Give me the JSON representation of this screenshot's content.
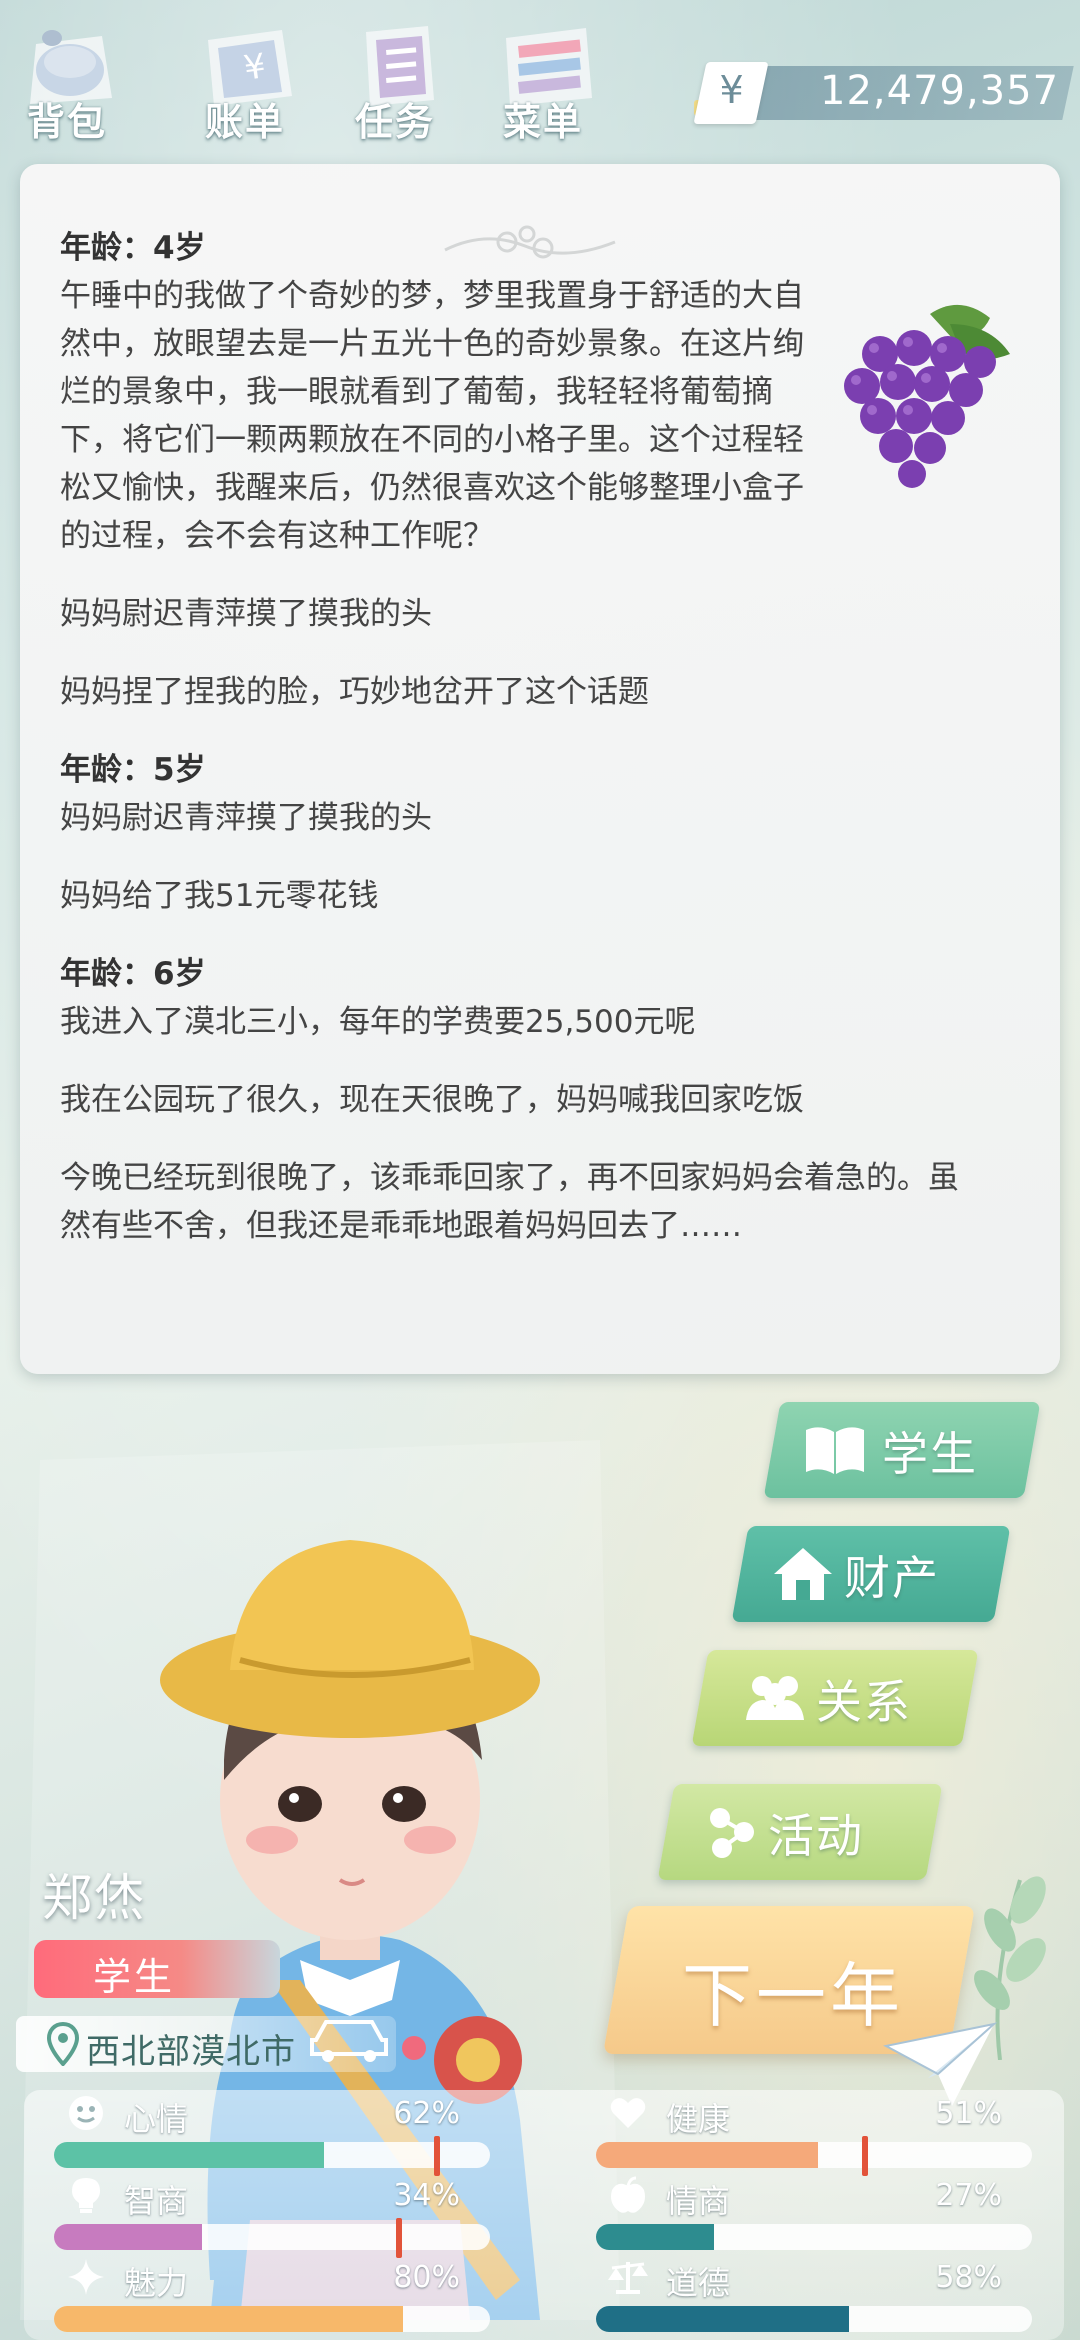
{
  "nav": {
    "items": [
      {
        "label": "背包",
        "icon": "backpack-icon"
      },
      {
        "label": "账单",
        "icon": "bill-icon"
      },
      {
        "label": "任务",
        "icon": "task-list-icon"
      },
      {
        "label": "菜单",
        "icon": "menu-icon"
      }
    ]
  },
  "money": {
    "icon": "yen-icon",
    "symbol": "¥",
    "value": "12,479,357"
  },
  "story": {
    "entries": [
      {
        "age": "年龄：4岁",
        "paragraphs": [
          "午睡中的我做了个奇妙的梦，梦里我置身于舒适的大自然中，放眼望去是一片五光十色的奇妙景象。在这片绚烂的景象中，我一眼就看到了葡萄，我轻轻将葡萄摘下，将它们一颗两颗放在不同的小格子里。这个过程轻松又愉快，我醒来后，仍然很喜欢这个能够整理小盒子的过程，会不会有这种工作呢？",
          "妈妈尉迟青萍摸了摸我的头",
          "妈妈捏了捏我的脸，巧妙地岔开了这个话题"
        ]
      },
      {
        "age": "年龄：5岁",
        "paragraphs": [
          "妈妈尉迟青萍摸了摸我的头",
          "妈妈给了我51元零花钱"
        ]
      },
      {
        "age": "年龄：6岁",
        "paragraphs": [
          "我进入了漠北三小，每年的学费要25,500元呢",
          "我在公园玩了很久，现在天很晚了，妈妈喊我回家吃饭",
          "今晚已经玩到很晚了，该乖乖回家了，再不回家妈妈会着急的。虽然有些不舍，但我还是乖乖地跟着妈妈回去了……"
        ]
      }
    ]
  },
  "character": {
    "name": "郑烋",
    "role": "学生",
    "location": "西北部漠北市"
  },
  "side_buttons": [
    {
      "label": "学生",
      "icon": "book-icon"
    },
    {
      "label": "财产",
      "icon": "house-icon"
    },
    {
      "label": "关系",
      "icon": "people-icon"
    },
    {
      "label": "活动",
      "icon": "activity-dots-icon"
    }
  ],
  "next_year": {
    "label": "下一年"
  },
  "stats": [
    {
      "label": "心情",
      "value": "62%",
      "fraction": 0.62,
      "icon": "smile-icon"
    },
    {
      "label": "健康",
      "value": "51%",
      "fraction": 0.51,
      "icon": "heart-icon"
    },
    {
      "label": "智商",
      "value": "34%",
      "fraction": 0.34,
      "icon": "lightbulb-icon"
    },
    {
      "label": "情商",
      "value": "27%",
      "fraction": 0.27,
      "icon": "apple-icon"
    },
    {
      "label": "魅力",
      "value": "80%",
      "fraction": 0.8,
      "icon": "sparkle-icon"
    },
    {
      "label": "道德",
      "value": "58%",
      "fraction": 0.58,
      "icon": "scales-icon"
    }
  ],
  "colors": {
    "mood_bar": "#5cc2a6",
    "health_bar": "#f5a97a",
    "iq_bar": "#c77bbf",
    "eq_bar": "#2d8c8f",
    "charm_bar": "#f7b86a",
    "morality_bar": "#1f6f86",
    "role_badge": "#ff6b7b",
    "next_year": "#f5c98a"
  }
}
